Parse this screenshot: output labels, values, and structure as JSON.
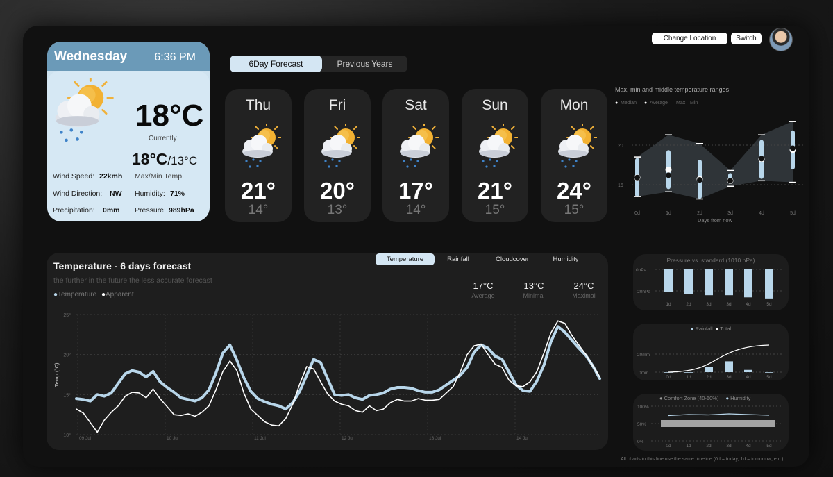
{
  "header": {
    "change_location_label": "Change Location",
    "switch_label": "Switch"
  },
  "today": {
    "day": "Wednesday",
    "time": "6:36 PM",
    "temp": "18°C",
    "currently_label": "Currently",
    "max": "18°C",
    "min": "/13°C",
    "maxmin_label": "Max/Min  Temp.",
    "wind_speed_label": "Wind Speed:",
    "wind_speed": "22kmh",
    "wind_direction_label": "Wind Direction:",
    "wind_direction": "NW",
    "humidity_label": "Humidity:",
    "humidity": "71%",
    "precipitation_label": "Precipitation:",
    "precipitation": "0mm",
    "pressure_label": "Pressure:",
    "pressure": "989hPa",
    "icon": "partly-cloudy-rain-icon"
  },
  "tabs": {
    "forecast": "6Day Forecast",
    "previous": "Previous Years"
  },
  "forecast": [
    {
      "day": "Thu",
      "hi": "21°",
      "lo": "14°",
      "icon": "partly-cloudy-rain-icon"
    },
    {
      "day": "Fri",
      "hi": "20°",
      "lo": "13°",
      "icon": "partly-cloudy-rain-icon"
    },
    {
      "day": "Sat",
      "hi": "17°",
      "lo": "14°",
      "icon": "partly-cloudy-rain-icon"
    },
    {
      "day": "Sun",
      "hi": "21°",
      "lo": "15°",
      "icon": "partly-cloudy-rain-icon"
    },
    {
      "day": "Mon",
      "hi": "24°",
      "lo": "15°",
      "icon": "partly-cloudy-rain-icon"
    }
  ],
  "main_chart": {
    "title": "Temperature - 6 days forecast",
    "subtitle": "the further in the future the less accurate forecast",
    "tabs": [
      "Temperature",
      "Rainfall",
      "Cloudcover",
      "Humidity"
    ],
    "stats": [
      {
        "value": "17°C",
        "label": "Average"
      },
      {
        "value": "13°C",
        "label": "Minimal"
      },
      {
        "value": "24°C",
        "label": "Maximal"
      }
    ]
  },
  "footnote": "All charts in this line use the same timeline (0d = today, 1d = tomorrow, etc.)",
  "chart_data": [
    {
      "type": "line",
      "title": "Temperature - 6 days forecast",
      "ylabel": "Temp (°C)",
      "ylim": [
        10,
        25
      ],
      "yticks": [
        "10°",
        "15°",
        "20°",
        "25°"
      ],
      "xticks": [
        "09 Jul",
        "10 Jul",
        "11 Jul",
        "12 Jul",
        "13 Jul",
        "14 Jul"
      ],
      "legend": [
        "Temperature",
        "Apparent"
      ],
      "series": [
        {
          "name": "Temperature",
          "color": "#b8d6ea",
          "values": [
            14.5,
            14.4,
            14.2,
            15.0,
            14.8,
            15.2,
            16.4,
            17.6,
            18.0,
            17.8,
            17.2,
            17.9,
            16.6,
            15.9,
            15.3,
            14.6,
            14.4,
            14.2,
            14.6,
            15.6,
            17.7,
            20.2,
            21.2,
            19.3,
            17.1,
            15.4,
            14.5,
            14.1,
            13.8,
            13.6,
            13.2,
            14.0,
            15.4,
            17.4,
            19.4,
            19.0,
            17.0,
            15.0,
            14.9,
            15.0,
            14.6,
            14.4,
            14.9,
            15.0,
            15.2,
            15.7,
            15.9,
            15.9,
            15.8,
            15.5,
            15.3,
            15.3,
            15.6,
            16.2,
            16.8,
            17.4,
            18.4,
            20.3,
            21.2,
            20.8,
            19.8,
            19.4,
            17.8,
            16.2,
            15.5,
            15.4,
            16.7,
            18.7,
            21.6,
            23.5,
            22.8,
            21.8,
            20.8,
            19.9,
            18.6,
            17.0
          ]
        },
        {
          "name": "Apparent",
          "color": "#ffffff",
          "values": [
            13.2,
            12.7,
            11.5,
            10.3,
            11.8,
            12.8,
            13.6,
            14.8,
            15.3,
            15.2,
            14.6,
            15.7,
            14.5,
            13.5,
            12.5,
            12.4,
            12.6,
            12.3,
            12.8,
            13.6,
            15.6,
            17.9,
            19.2,
            18.0,
            15.2,
            13.2,
            12.4,
            11.6,
            11.2,
            11.1,
            12.0,
            13.8,
            16.3,
            18.5,
            18.2,
            16.6,
            15.1,
            14.2,
            13.8,
            13.6,
            13.0,
            12.8,
            13.6,
            13.0,
            13.2,
            14.0,
            14.4,
            14.2,
            14.2,
            14.5,
            14.3,
            14.3,
            14.4,
            15.2,
            16.0,
            17.8,
            20.0,
            21.1,
            21.3,
            20.0,
            18.8,
            18.4,
            16.8,
            16.1,
            16.0,
            16.6,
            17.9,
            20.2,
            22.7,
            24.2,
            23.9,
            22.4,
            21.2,
            20.0,
            18.6,
            17.2
          ]
        }
      ]
    },
    {
      "type": "scatter",
      "title": "Max, min and middle temperature ranges",
      "xlabel": "Days from now",
      "categories": [
        "0d",
        "1d",
        "2d",
        "3d",
        "4d",
        "5d"
      ],
      "yticks": [
        "15",
        "20"
      ],
      "legend": [
        "Median",
        "Average",
        "Max",
        "Min"
      ],
      "median": [
        15.9,
        16.2,
        15.6,
        15.5,
        18.3,
        19.6
      ],
      "average": [
        15.9,
        16.9,
        15.7,
        15.5,
        18.2,
        19.4
      ],
      "max": [
        18.5,
        21.3,
        20.2,
        16.8,
        21.3,
        23.0
      ],
      "min": [
        13.5,
        14.1,
        13.2,
        14.8,
        15.5,
        15.3
      ]
    },
    {
      "type": "bar",
      "title": "Pressure vs. standard (1010 hPa)",
      "categories": [
        "1d",
        "2d",
        "3d",
        "3d",
        "4d",
        "5d"
      ],
      "yticks": [
        "0hPa",
        "-20hPa"
      ],
      "values": [
        -21,
        -23,
        -24,
        -24,
        -26,
        -27
      ]
    },
    {
      "type": "bar",
      "categories": [
        "0d",
        "1d",
        "2d",
        "3d",
        "4d",
        "5d"
      ],
      "legend": [
        "Rainfall",
        "Total"
      ],
      "yticks": [
        "0mm",
        "20mm"
      ],
      "values": [
        0,
        0,
        6,
        12,
        2.5,
        0
      ],
      "total": [
        0,
        0.5,
        6,
        18,
        20.5,
        21
      ]
    },
    {
      "type": "line",
      "categories": [
        "0d",
        "1d",
        "2d",
        "3d",
        "4d",
        "5d"
      ],
      "legend": [
        "Comfort Zone (40-60%)",
        "Humidity"
      ],
      "yticks": [
        "100%",
        "50%",
        "0%"
      ],
      "values": [
        73,
        76,
        75,
        78,
        76,
        74
      ]
    }
  ]
}
